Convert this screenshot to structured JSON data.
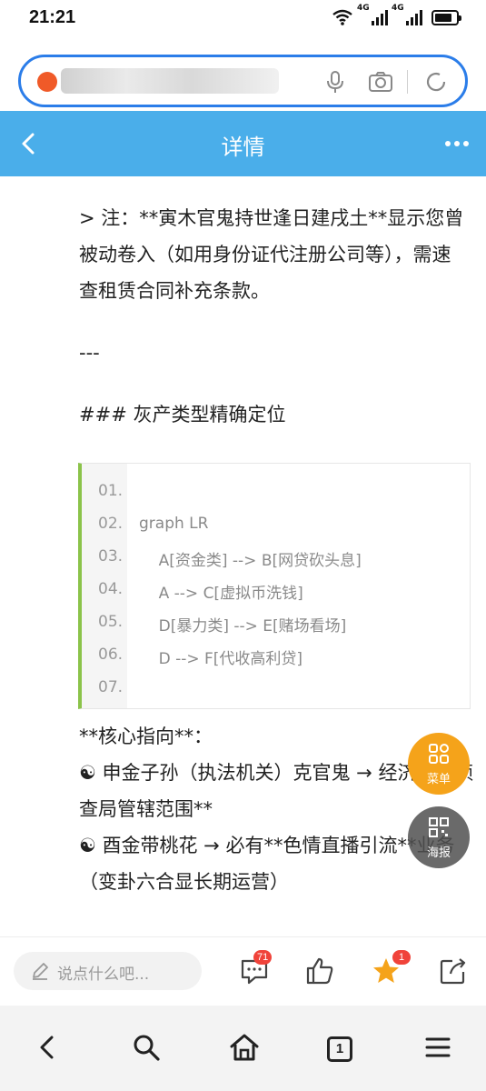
{
  "status_bar": {
    "time": "21:21",
    "network_1": "4G",
    "network_2": "4G"
  },
  "title_bar": {
    "title": "详情"
  },
  "article": {
    "note": "> 注：**寅木官鬼持世逢日建戌土**显示您曾被动卷入（如用身份证代注册公司等），需速查租赁合同补充条款。",
    "hr": "---",
    "heading": "### 灰产类型精确定位",
    "code_lines": [
      {
        "num": "01.",
        "text": ""
      },
      {
        "num": "02.",
        "text": "graph LR"
      },
      {
        "num": "03.",
        "text": "    A[资金类] --> B[网贷砍头息]"
      },
      {
        "num": "04.",
        "text": "    A --> C[虚拟币洗钱]"
      },
      {
        "num": "05.",
        "text": "    D[暴力类] --> E[赌场看场]"
      },
      {
        "num": "06.",
        "text": "    D --> F[代收高利贷]"
      },
      {
        "num": "07.",
        "text": ""
      }
    ],
    "core_label": "**核心指向**：",
    "core_line1": "☯ 申金子孙（执法机关）克官鬼 → 经济犯罪侦查局管辖范围**",
    "core_line2": "☯ 酉金带桃花 → 必有**色情直播引流**业务（变卦六合显长期运营）"
  },
  "floating": {
    "menu_label": "菜单",
    "poster_label": "海报"
  },
  "comment_bar": {
    "placeholder": "说点什么吧...",
    "comment_count": "71",
    "favorite_count": "1"
  },
  "nav_bar": {
    "tab_count": "1"
  },
  "colors": {
    "accent": "#4aaeea",
    "url_border": "#2b7de9",
    "fab_menu": "#f5a31a",
    "code_bar": "#8bc34a",
    "badge": "#f0433a"
  }
}
